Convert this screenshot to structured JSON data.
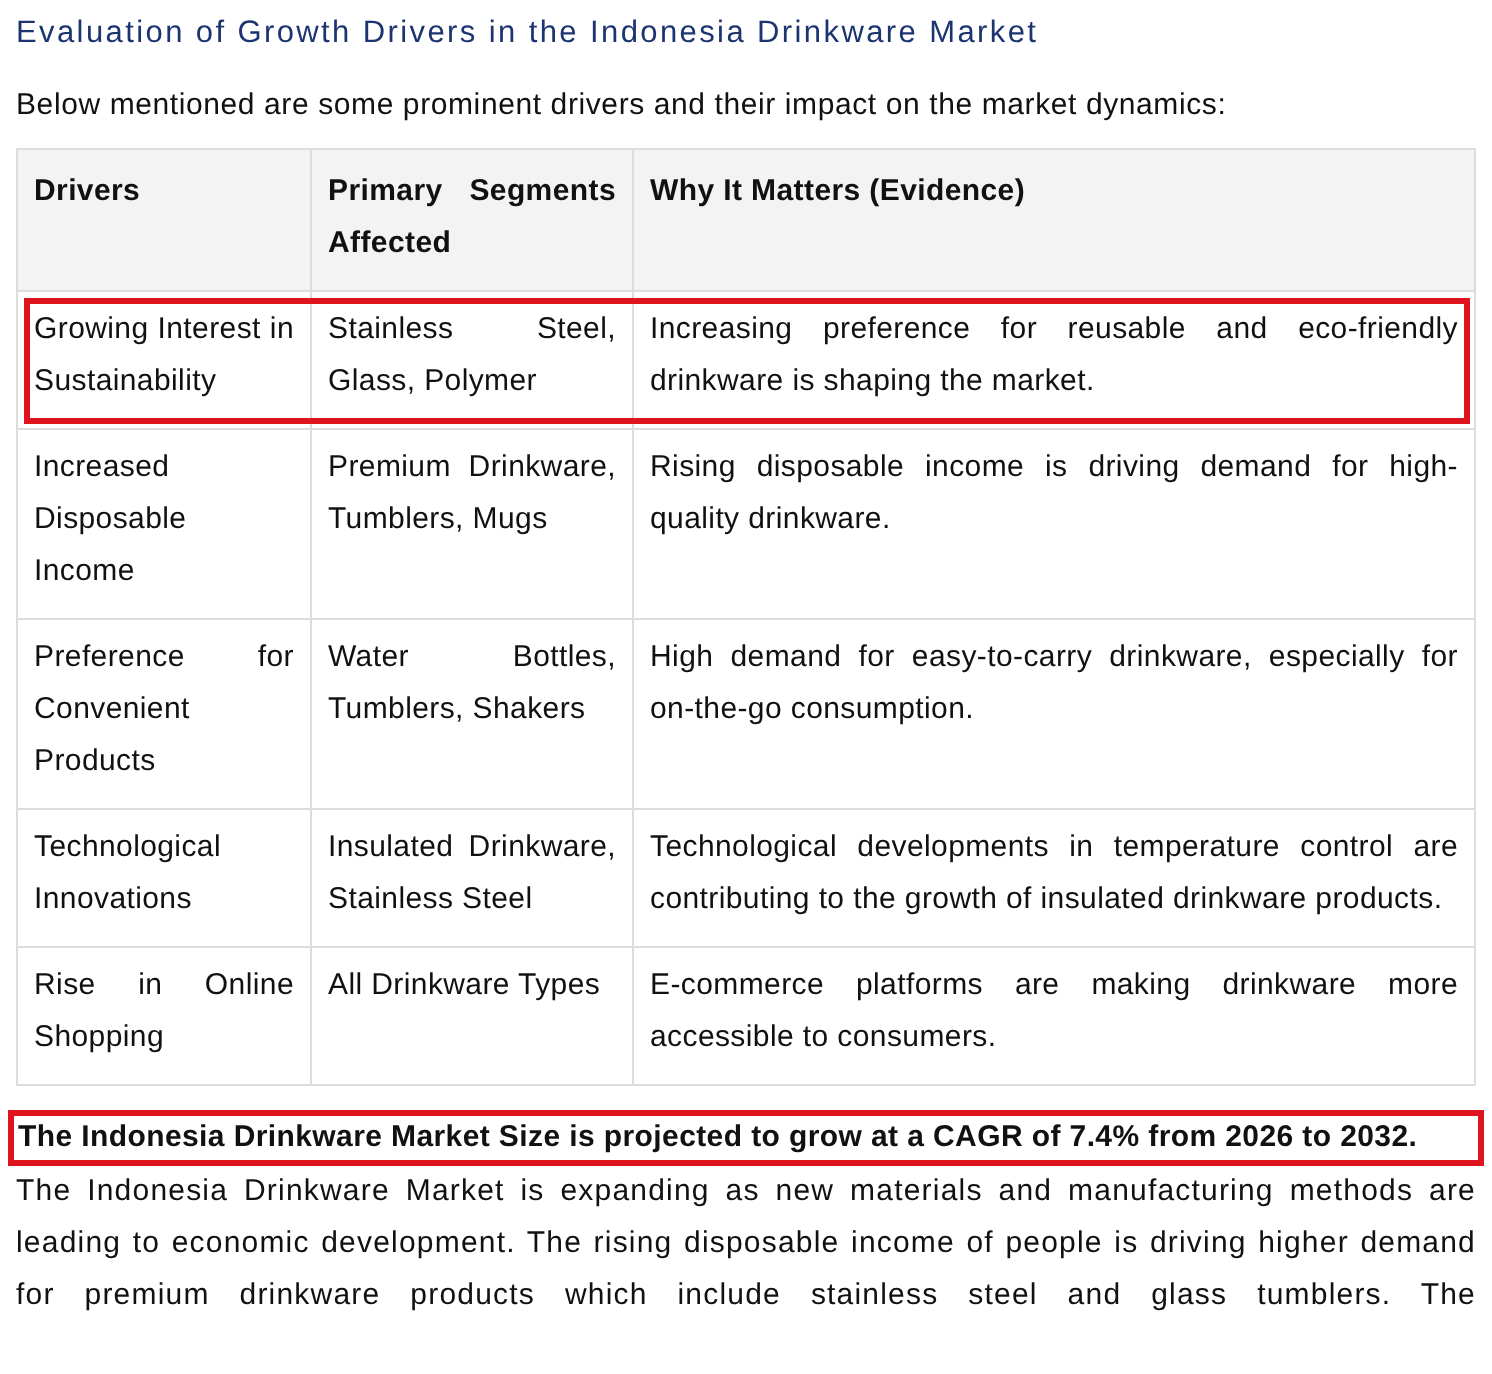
{
  "title": "Evaluation of Growth Drivers in the Indonesia Drinkware Market",
  "intro": "Below mentioned are some prominent drivers and their impact on the market dynamics:",
  "table": {
    "columns": [
      "Drivers",
      "Primary Segments Affected",
      "Why It Matters (Evidence)"
    ],
    "rows": [
      {
        "cells": [
          "Growing Interest in Sustainability",
          "Stainless Steel, Glass, Polymer",
          "Increasing preference for reusable and eco-friendly drinkware is shaping the market."
        ],
        "highlighted": true
      },
      {
        "cells": [
          "Increased Disposable Income",
          "Premium Drinkware, Tumblers, Mugs",
          "Rising disposable income is driving demand for high-quality drinkware."
        ],
        "highlighted": false
      },
      {
        "cells": [
          "Preference for Convenient Products",
          "Water Bottles, Tumblers, Shakers",
          "High demand for easy-to-carry drinkware, especially for on-the-go consumption."
        ],
        "highlighted": false
      },
      {
        "cells": [
          "Technological Innovations",
          "Insulated Drinkware, Stainless Steel",
          "Technological developments in temperature control are contributing to the growth of insulated drinkware products."
        ],
        "highlighted": false
      },
      {
        "cells": [
          "Rise in Online Shopping",
          "All Drinkware Types",
          "E-commerce platforms are making drinkware more accessible to consumers."
        ],
        "highlighted": false
      }
    ]
  },
  "headline": {
    "text": "The Indonesia Drinkware Market Size is projected to grow at a CAGR of 7.4% from 2026 to 2032.",
    "highlighted": true
  },
  "paragraph": "The Indonesia Drinkware Market is expanding as new materials and manufacturing methods are leading to economic development. The rising disposable income of people is driving higher demand for premium drinkware products which include stainless steel and glass tumblers. The"
}
